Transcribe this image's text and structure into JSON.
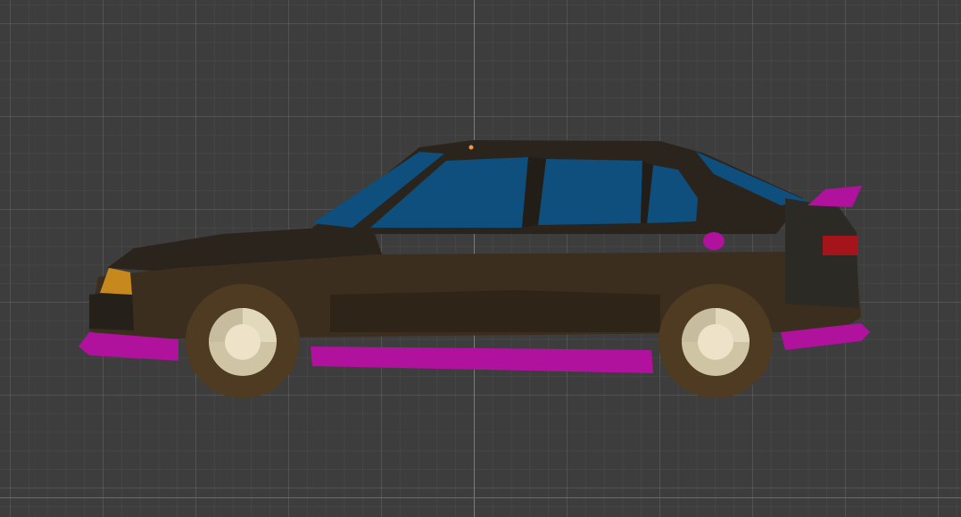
{
  "viewport": {
    "mode": "orthographic-side-view",
    "grid": true
  },
  "axes": {
    "z_color": "#5a7fc8",
    "x_color": "#b8484f"
  },
  "car": {
    "body_color": "#3b2e1f",
    "roof_color": "#2a241d",
    "window_color": "#0e4f7e",
    "trim_color": "#b0129e",
    "wheel_tire_color": "#4f3b22",
    "wheel_rim_color": "#d8ccab",
    "headlight_color": "#c7891e",
    "taillight_color": "#a3141b"
  },
  "origin_marker_color": "#e89a47"
}
